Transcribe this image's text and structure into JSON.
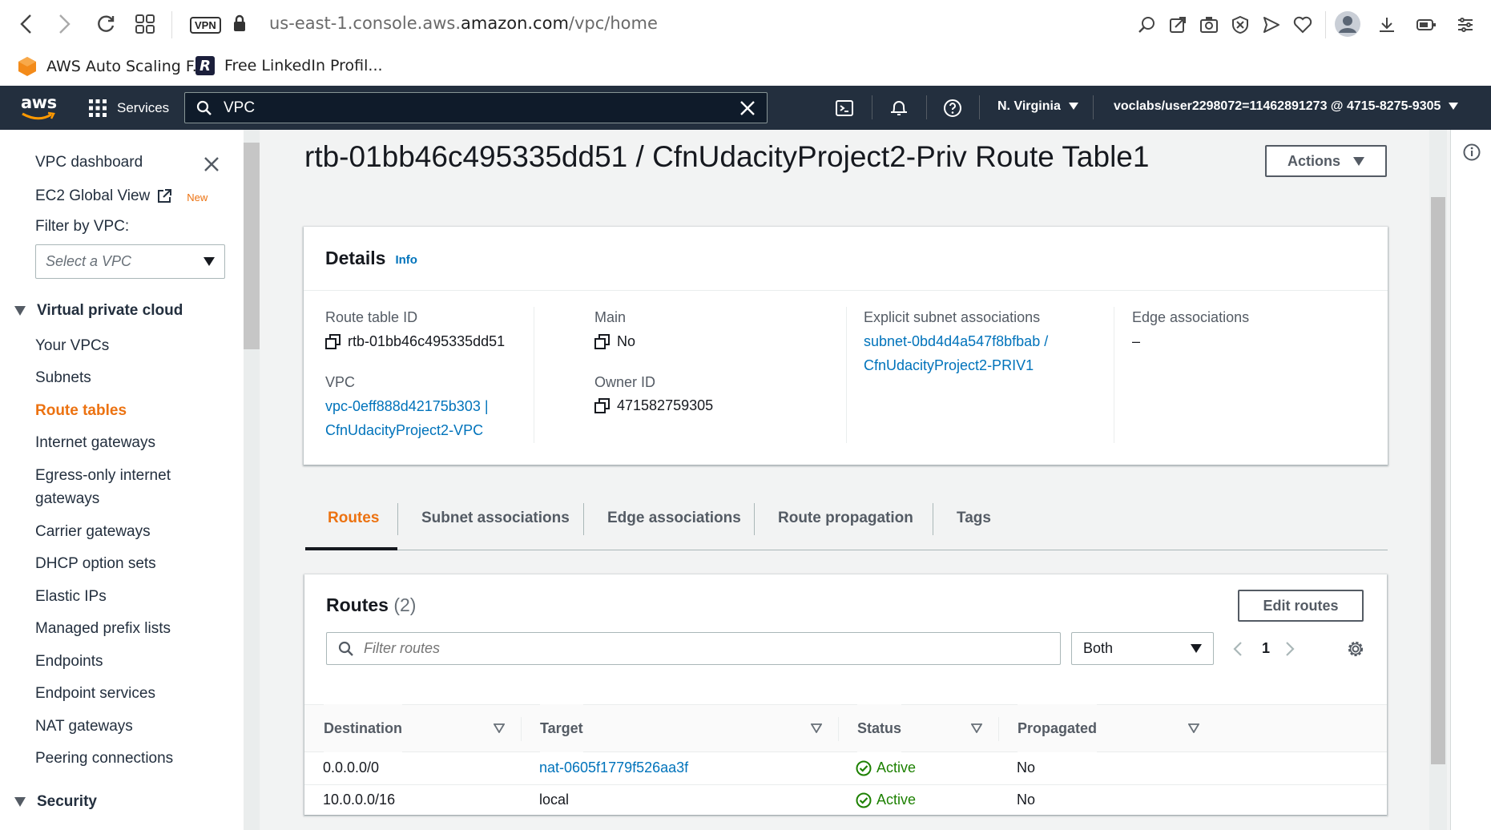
{
  "browser": {
    "url_prefix": "us-east-1.console.aws.",
    "url_host": "amazon.com",
    "url_path": "/vpc/home",
    "vpn_label": "VPN",
    "bookmarks": [
      {
        "label": "AWS Auto Scaling F..."
      },
      {
        "label": "Free LinkedIn Profil..."
      }
    ]
  },
  "aws_nav": {
    "logo": "aws",
    "services_label": "Services",
    "search_value": "VPC",
    "region": "N. Virginia",
    "account": "voclabs/user2298072=11462891273 @ 4715-8275-9305"
  },
  "sidebar": {
    "top_items": [
      {
        "label": "VPC dashboard"
      },
      {
        "label": "EC2 Global View",
        "badge": "New"
      }
    ],
    "filter_label": "Filter by VPC:",
    "filter_placeholder": "Select a VPC",
    "section_vpc": "Virtual private cloud",
    "items": [
      {
        "label": "Your VPCs"
      },
      {
        "label": "Subnets"
      },
      {
        "label": "Route tables",
        "active": true
      },
      {
        "label": "Internet gateways"
      },
      {
        "label": "Egress-only internet"
      },
      {
        "label": "gateways"
      },
      {
        "label": "Carrier gateways"
      },
      {
        "label": "DHCP option sets"
      },
      {
        "label": "Elastic IPs"
      },
      {
        "label": "Managed prefix lists"
      },
      {
        "label": "Endpoints"
      },
      {
        "label": "Endpoint services"
      },
      {
        "label": "NAT gateways"
      },
      {
        "label": "Peering connections"
      }
    ],
    "section_security": "Security"
  },
  "page": {
    "title": "rtb-01bb46c495335dd51 / CfnUdacityProject2-Priv Route Table1",
    "actions_label": "Actions"
  },
  "details": {
    "heading": "Details",
    "info": "Info",
    "route_table_id_label": "Route table ID",
    "route_table_id": "rtb-01bb46c495335dd51",
    "vpc_label": "VPC",
    "vpc_line1": "vpc-0eff888d42175b303 |",
    "vpc_line2": "CfnUdacityProject2-VPC",
    "main_label": "Main",
    "main_value": "No",
    "owner_label": "Owner ID",
    "owner_value": "471582759305",
    "subnet_label": "Explicit subnet associations",
    "subnet_line1": "subnet-0bd4d4a547f8bfbab /",
    "subnet_line2": "CfnUdacityProject2-PRIV1",
    "edge_label": "Edge associations",
    "edge_value": "–"
  },
  "tabs": [
    {
      "label": "Routes",
      "active": true
    },
    {
      "label": "Subnet associations"
    },
    {
      "label": "Edge associations"
    },
    {
      "label": "Route propagation"
    },
    {
      "label": "Tags"
    }
  ],
  "routes": {
    "title": "Routes",
    "count": "(2)",
    "edit_label": "Edit routes",
    "filter_placeholder": "Filter routes",
    "both_label": "Both",
    "page_number": "1",
    "columns": [
      "Destination",
      "Target",
      "Status",
      "Propagated"
    ],
    "rows": [
      {
        "destination": "0.0.0.0/0",
        "target": "nat-0605f1779f526aa3f",
        "target_link": true,
        "status": "Active",
        "propagated": "No"
      },
      {
        "destination": "10.0.0.0/16",
        "target": "local",
        "target_link": false,
        "status": "Active",
        "propagated": "No"
      }
    ]
  },
  "colors": {
    "accent": "#ec7211",
    "link": "#0073bb",
    "nav_bg": "#232f3e",
    "success": "#1d8102"
  }
}
